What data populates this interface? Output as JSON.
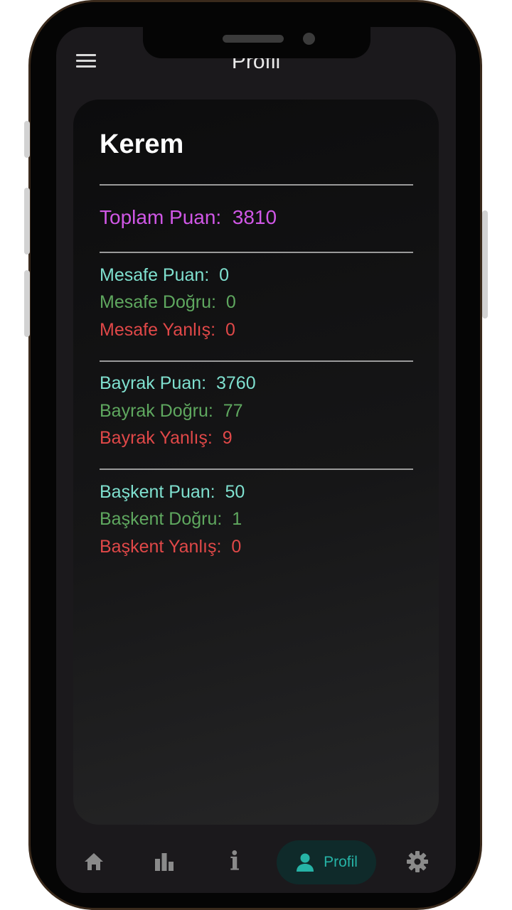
{
  "header": {
    "title": "Profil"
  },
  "profile": {
    "name": "Kerem",
    "total": {
      "label": "Toplam Puan:",
      "value": "3810"
    },
    "sections": [
      {
        "puan_label": "Mesafe Puan:",
        "puan": "0",
        "dogru_label": "Mesafe Doğru:",
        "dogru": "0",
        "yanlis_label": "Mesafe Yanlış:",
        "yanlis": "0"
      },
      {
        "puan_label": "Bayrak Puan:",
        "puan": "3760",
        "dogru_label": "Bayrak Doğru:",
        "dogru": "77",
        "yanlis_label": "Bayrak Yanlış:",
        "yanlis": "9"
      },
      {
        "puan_label": "Başkent Puan:",
        "puan": "50",
        "dogru_label": "Başkent Doğru:",
        "dogru": "1",
        "yanlis_label": "Başkent Yanlış:",
        "yanlis": "0"
      }
    ]
  },
  "nav": {
    "items": [
      {
        "icon": "home-icon"
      },
      {
        "icon": "bar-chart-icon"
      },
      {
        "icon": "info-icon"
      },
      {
        "icon": "person-icon",
        "label": "Profil",
        "active": true
      },
      {
        "icon": "gear-icon"
      }
    ]
  },
  "colors": {
    "total": "#d057e6",
    "puan": "#7fe0cf",
    "dogru": "#5fa85f",
    "yanlis": "#e04848",
    "active_nav": "#26b3a6"
  }
}
